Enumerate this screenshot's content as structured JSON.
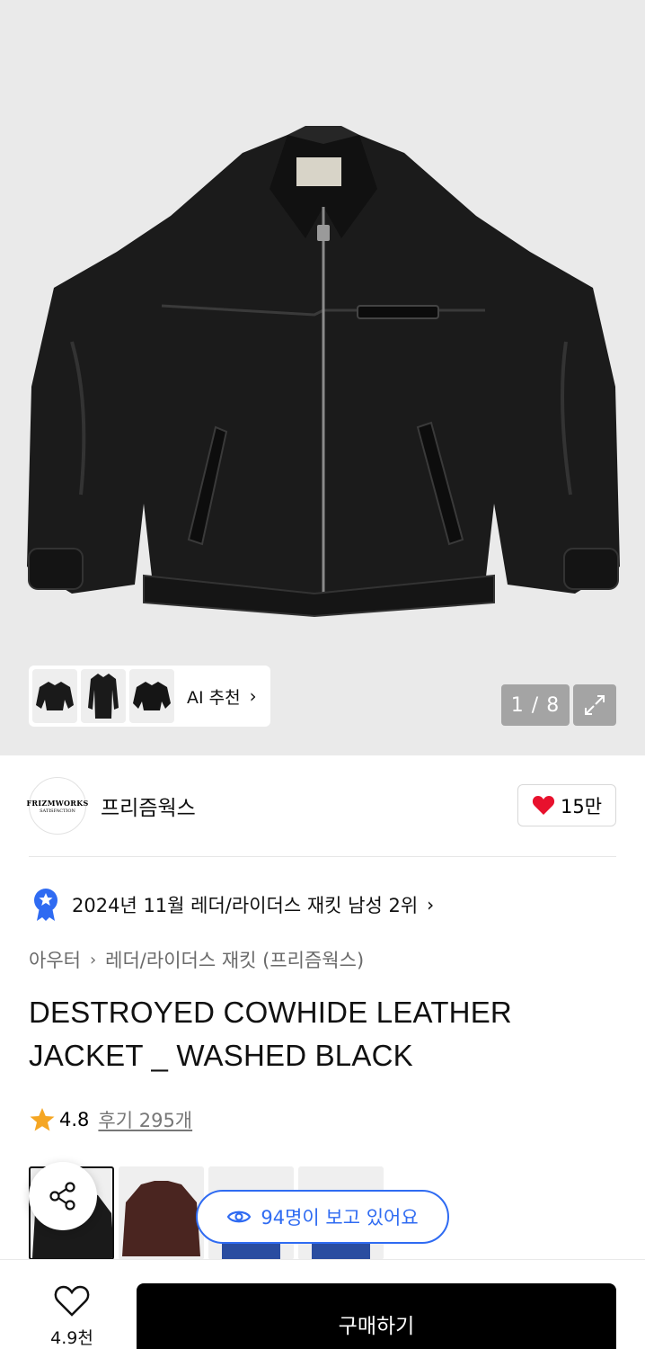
{
  "gallery": {
    "ai_label": "AI 추천",
    "counter": "1 / 8",
    "current_index": 1,
    "total": 8
  },
  "brand": {
    "name": "프리즘웍스",
    "logo_text_top": "FRIZMWORKS",
    "logo_text_bottom": "SATISFACTION",
    "likes": "15만"
  },
  "ranking": {
    "text": "2024년 11월 레더/라이더스 재킷 남성 2위"
  },
  "breadcrumb": {
    "level1": "아우터",
    "level2": "레더/라이더스 재킷 (프리즘웍스)"
  },
  "product": {
    "title": "DESTROYED COWHIDE LEATHER JACKET _ WASHED BLACK",
    "rating": "4.8",
    "reviews": "후기 295개"
  },
  "viewers": {
    "text": "94명이 보고 있어요"
  },
  "bottom_bar": {
    "wish_count": "4.9천",
    "buy_label": "구매하기"
  },
  "icons": {
    "heart_color": "#e8112d",
    "star_color": "#f5a623",
    "accent_blue": "#2f6bf2"
  }
}
